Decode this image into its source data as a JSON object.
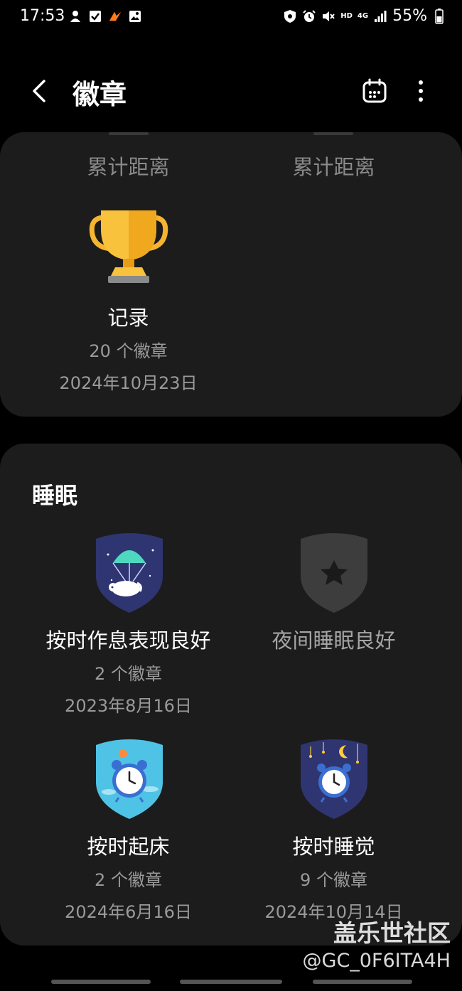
{
  "status": {
    "time": "17:53",
    "network_hd": "HD",
    "network_4g": "4G",
    "battery": "55%"
  },
  "header": {
    "title": "徽章"
  },
  "distance_section": {
    "tabs": [
      "累计距离",
      "累计距离"
    ],
    "badges": [
      {
        "name": "记录",
        "count": "20 个徽章",
        "date": "2024年10月23日",
        "icon": "trophy-icon"
      }
    ]
  },
  "sleep_section": {
    "title": "睡眠",
    "badges": [
      {
        "name": "按时作息表现良好",
        "count": "2 个徽章",
        "date": "2023年8月16日",
        "icon": "parachute-sheep-badge-icon"
      },
      {
        "name": "夜间睡眠良好",
        "icon": "locked-star-badge-icon"
      },
      {
        "name": "按时起床",
        "count": "2 个徽章",
        "date": "2024年6月16日",
        "icon": "alarm-clock-day-badge-icon"
      },
      {
        "name": "按时睡觉",
        "count": "9 个徽章",
        "date": "2024年10月14日",
        "icon": "alarm-clock-night-badge-icon"
      }
    ]
  },
  "watermark": {
    "main": "盖乐世社区",
    "sub": "@GC_0F6ITA4H"
  },
  "colors": {
    "background": "#000000",
    "card": "#1c1c1c",
    "secondary_text": "#9a9a9a",
    "trophy_gold": "#f5b52e"
  }
}
